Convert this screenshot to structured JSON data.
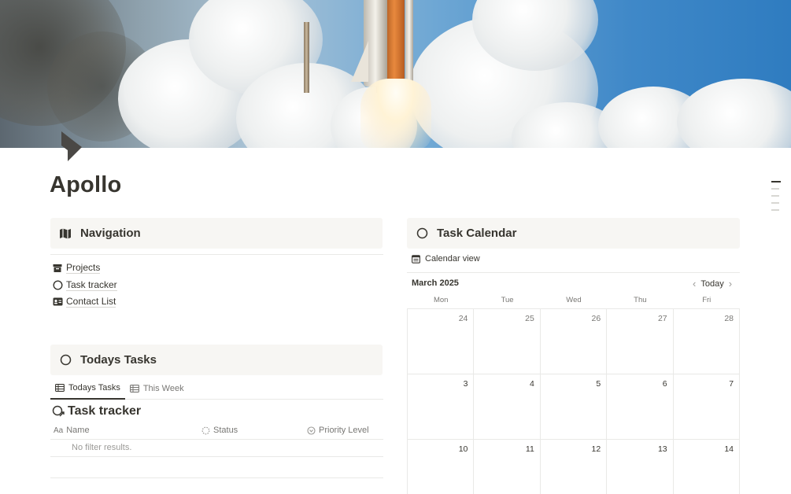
{
  "page": {
    "title": "Apollo"
  },
  "navigation": {
    "heading": "Navigation",
    "items": [
      {
        "label": "Projects",
        "icon": "archive-icon"
      },
      {
        "label": "Task tracker",
        "icon": "circle-icon"
      },
      {
        "label": "Contact List",
        "icon": "contact-card-icon"
      }
    ]
  },
  "todays_tasks": {
    "heading": "Todays Tasks",
    "tabs": [
      {
        "label": "Todays Tasks",
        "active": true
      },
      {
        "label": "This Week",
        "active": false
      }
    ],
    "database_title": "Task tracker",
    "columns": [
      {
        "label": "Name",
        "icon": "Aa"
      },
      {
        "label": "Status",
        "icon": "status-icon"
      },
      {
        "label": "Priority Level",
        "icon": "priority-icon"
      }
    ],
    "empty_text": "No filter results."
  },
  "task_calendar": {
    "heading": "Task Calendar",
    "view_label": "Calendar view",
    "month": "March 2025",
    "today_label": "Today",
    "weekdays": [
      "Mon",
      "Tue",
      "Wed",
      "Thu",
      "Fri"
    ],
    "weeks": [
      [
        "24",
        "25",
        "26",
        "27",
        "28"
      ],
      [
        "3",
        "4",
        "5",
        "6",
        "7"
      ],
      [
        "10",
        "11",
        "12",
        "13",
        "14"
      ]
    ]
  },
  "colors": {
    "text": "#37352f",
    "muted": "#787774",
    "callout_bg": "#f7f6f3",
    "border": "#e9e9e7"
  }
}
